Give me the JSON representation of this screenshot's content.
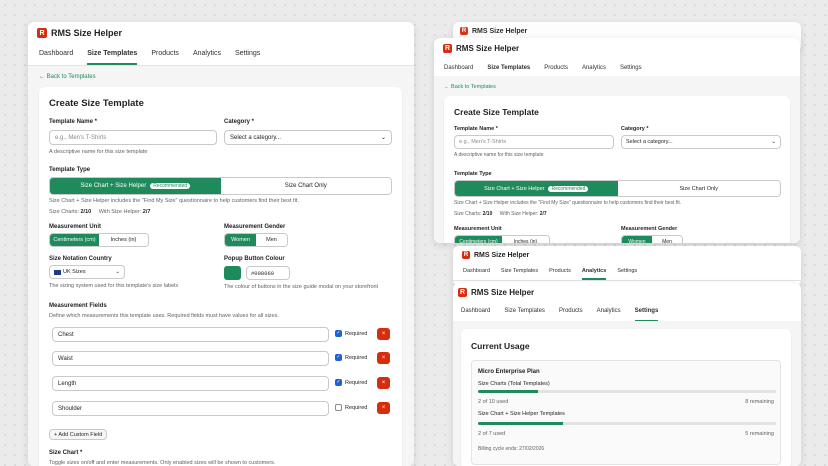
{
  "app": {
    "name": "RMS Size Helper",
    "logo_letter": "R"
  },
  "nav": [
    "Dashboard",
    "Size Templates",
    "Products",
    "Analytics",
    "Settings"
  ],
  "back_link": "← Back to Templates",
  "create": {
    "title": "Create Size Template",
    "template_name": {
      "label": "Template Name *",
      "placeholder": "e.g., Men's T-Shirts",
      "help": "A descriptive name for this size template"
    },
    "category": {
      "label": "Category *",
      "value": "Select a category..."
    },
    "template_type": {
      "label": "Template Type",
      "options": [
        "Size Chart + Size Helper",
        "Size Chart Only"
      ],
      "badge": "Recommended",
      "help": "Size Chart + Size Helper includes the \"Find My Size\" questionnaire to help customers find their best fit.",
      "size_charts_label": "Size Charts:",
      "size_charts_value": "2/10",
      "with_helper_label": "With Size Helper:",
      "with_helper_value": "2/7"
    },
    "measurement_unit": {
      "label": "Measurement Unit",
      "options": [
        "Centimeters (cm)",
        "Inches (in)"
      ]
    },
    "measurement_gender": {
      "label": "Measurement Gender",
      "options": [
        "Women",
        "Men"
      ]
    },
    "size_notation": {
      "label": "Size Notation Country",
      "value": "UK Sizes",
      "help": "The sizing system used for this template's size labels"
    },
    "popup_colour": {
      "label": "Popup Button Colour",
      "value": "#008060",
      "swatch": "#1f8b5c",
      "help": "The colour of buttons in the size guide modal on your storefront"
    },
    "fields": {
      "label": "Measurement Fields",
      "help": "Define which measurements this template uses. Required fields must have values for all sizes.",
      "items": [
        {
          "name": "Chest",
          "required_label": "Required",
          "checked": true
        },
        {
          "name": "Waist",
          "required_label": "Required",
          "checked": true
        },
        {
          "name": "Length",
          "required_label": "Required",
          "checked": true
        },
        {
          "name": "Shoulder",
          "required_label": "Required",
          "checked": false
        }
      ],
      "add_label": "+ Add Custom Field"
    },
    "size_chart": {
      "label": "Size Chart *",
      "help": "Toggle sizes on/off and enter measurements. Only enabled sizes will be shown to customers."
    }
  },
  "usage": {
    "title": "Current Usage",
    "plan": "Micro Enterprise Plan",
    "rows": [
      {
        "label": "Size Charts (Total Templates)",
        "used": "2 of 10 used",
        "remaining": "8 remaining",
        "fraction": 0.2
      },
      {
        "label": "Size Chart + Size Helper Templates",
        "used": "2 of 7 used",
        "remaining": "5 remaining",
        "fraction": 0.286
      }
    ],
    "billing": "Billing cycle ends: 27/02/2026"
  },
  "colors": {
    "accent": "#1f8b5c",
    "danger": "#d72c0d",
    "checkbox": "#1f5fd4"
  }
}
